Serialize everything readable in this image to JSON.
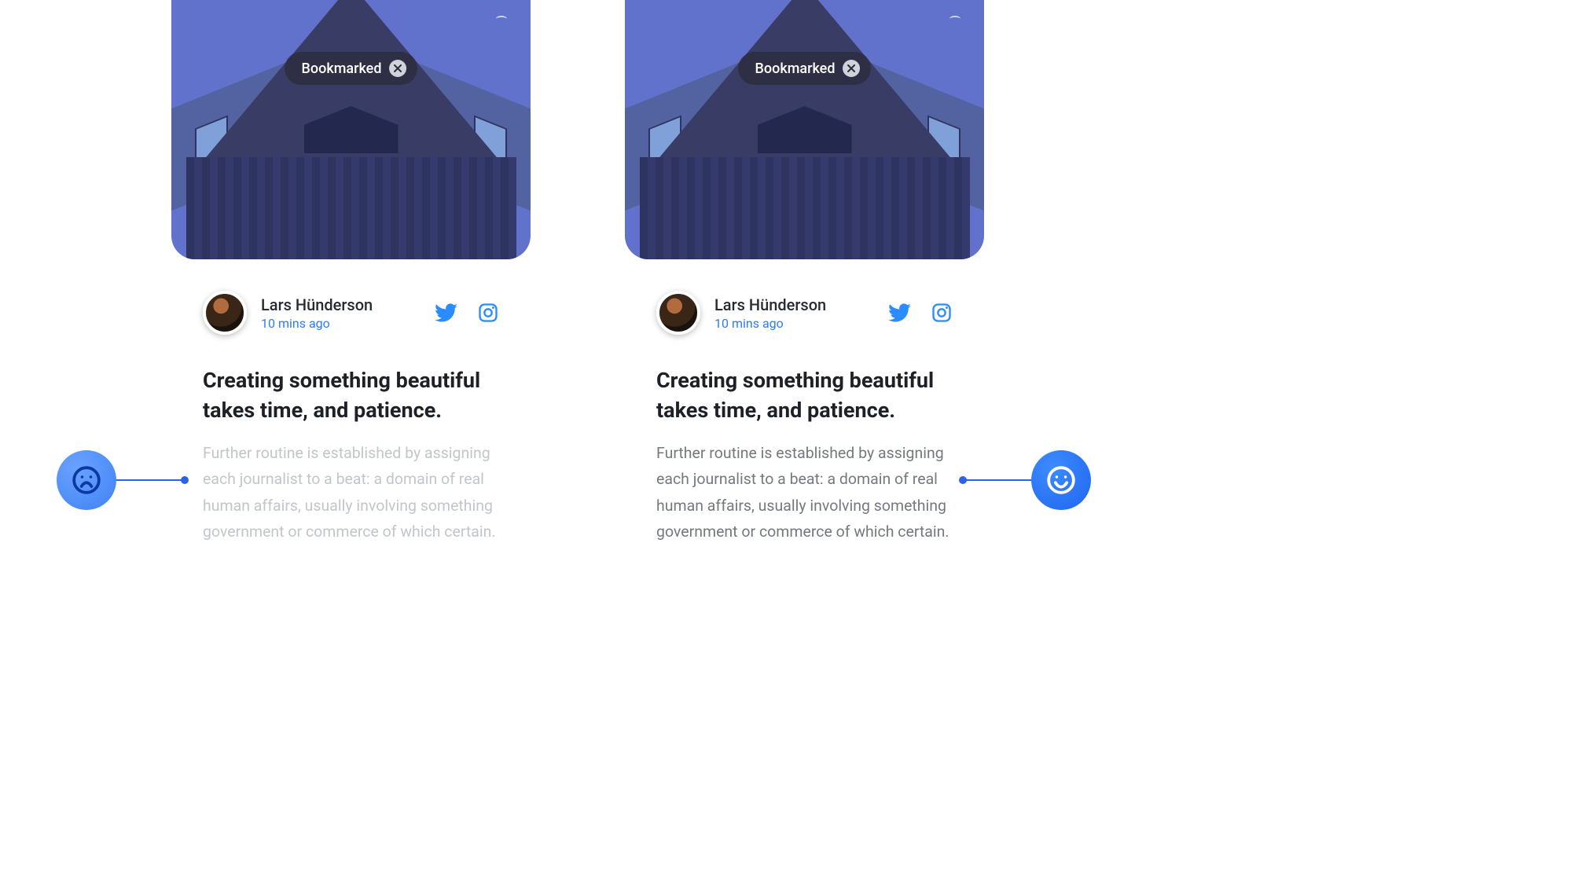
{
  "badge": {
    "label": "Bookmarked"
  },
  "author": {
    "name": "Lars Hünderson",
    "time": "10 mins ago"
  },
  "social": {
    "twitter_name": "twitter-icon",
    "instagram_name": "instagram-icon"
  },
  "post": {
    "title": "Creating something beautiful takes time, and patience.",
    "body": "Further routine is established by assigning each journalist to a beat: a domain of real human affairs, usually involving something government or commerce of which certain."
  },
  "colors": {
    "accent": "#2a7cff",
    "body_light": "#c2c5cb",
    "body_dark": "#74787f"
  },
  "feedback": {
    "sad": "sad-face-icon",
    "happy": "happy-face-icon"
  }
}
